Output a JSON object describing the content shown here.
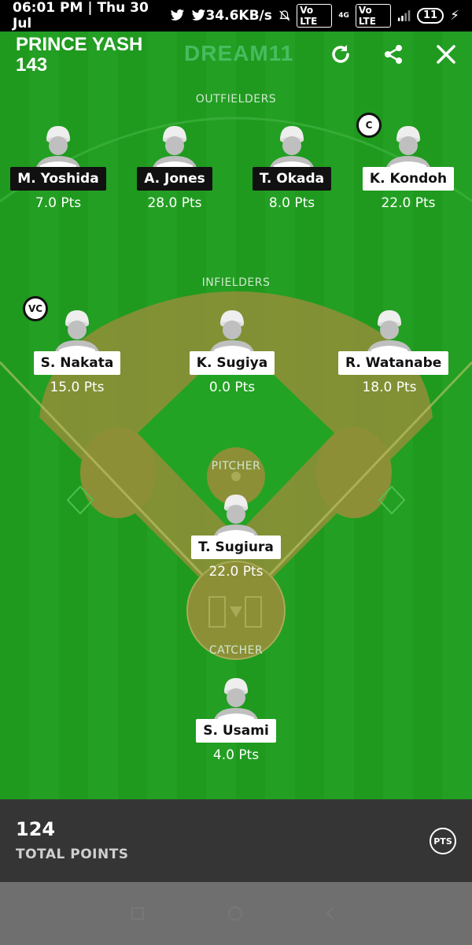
{
  "status_bar": {
    "time": "06:01 PM | Thu 30 Jul",
    "speed": "34.6KB/s",
    "net1": "Vo LTE",
    "net_gen": "4G",
    "net2": "Vo LTE",
    "battery": "11"
  },
  "header": {
    "team_name_line1": "PRINCE YASH",
    "team_name_line2": "143",
    "brand": "DREAM11"
  },
  "sections": {
    "outfielders": "OUTFIELDERS",
    "infielders": "INFIELDERS",
    "pitcher": "PITCHER",
    "catcher": "CATCHER"
  },
  "badges": {
    "captain": "C",
    "vice_captain": "VC"
  },
  "players": {
    "outfielders": [
      {
        "name": "M. Yoshida",
        "points": "7.0 Pts",
        "style": "dark"
      },
      {
        "name": "A. Jones",
        "points": "28.0 Pts",
        "style": "dark"
      },
      {
        "name": "T. Okada",
        "points": "8.0 Pts",
        "style": "dark"
      },
      {
        "name": "K. Kondoh",
        "points": "22.0 Pts",
        "style": "light"
      }
    ],
    "infielders": [
      {
        "name": "S. Nakata",
        "points": "15.0 Pts",
        "style": "light"
      },
      {
        "name": "K. Sugiya",
        "points": "0.0 Pts",
        "style": "light"
      },
      {
        "name": "R. Watanabe",
        "points": "18.0 Pts",
        "style": "light"
      }
    ],
    "pitcher": {
      "name": "T. Sugiura",
      "points": "22.0 Pts",
      "style": "light"
    },
    "catcher": {
      "name": "S. Usami",
      "points": "4.0 Pts",
      "style": "light"
    }
  },
  "footer": {
    "total_value": "124",
    "total_label": "TOTAL POINTS",
    "pts_button": "PTS"
  }
}
